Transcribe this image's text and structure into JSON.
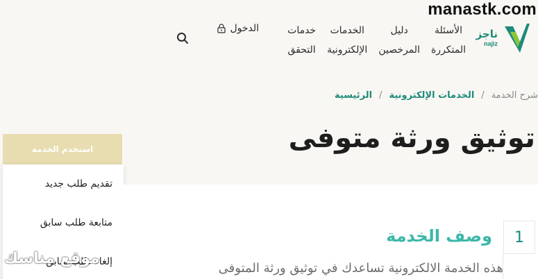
{
  "watermark": "manastk.com",
  "logo": {
    "arabic": "ناجز",
    "english": "najiz"
  },
  "nav": [
    {
      "line1": "خدمات",
      "line2": "التحقق"
    },
    {
      "line1": "الخدمات",
      "line2": "الإلكترونية"
    },
    {
      "line1": "دليل",
      "line2": "المرخصين"
    },
    {
      "line1": "الأسئلة",
      "line2": "المتكررة"
    }
  ],
  "login_label": "الدخول",
  "breadcrumb": {
    "home": "الرئيسية",
    "section": "الخدمات الإلكترونية",
    "current": "شرح الخدمة",
    "sep": "/"
  },
  "page_title": "توثيق ورثة متوفى",
  "use_button": "استخدم الخدمة",
  "dropdown": [
    "تقديم طلب جديد",
    "متابعة طلب سابق",
    "إلغاء طلب سابق"
  ],
  "step_number": "1",
  "section_title": "وصف الخدمة",
  "description": "هذه الخدمة الالكترونية تساعدك في توثيق ورثة المتوفى",
  "overlay_text": "موقع مناسك",
  "colors": {
    "brand_teal": "#1d8a7a",
    "accent_teal": "#3cb8a8",
    "gold": "#e8ddb0"
  }
}
